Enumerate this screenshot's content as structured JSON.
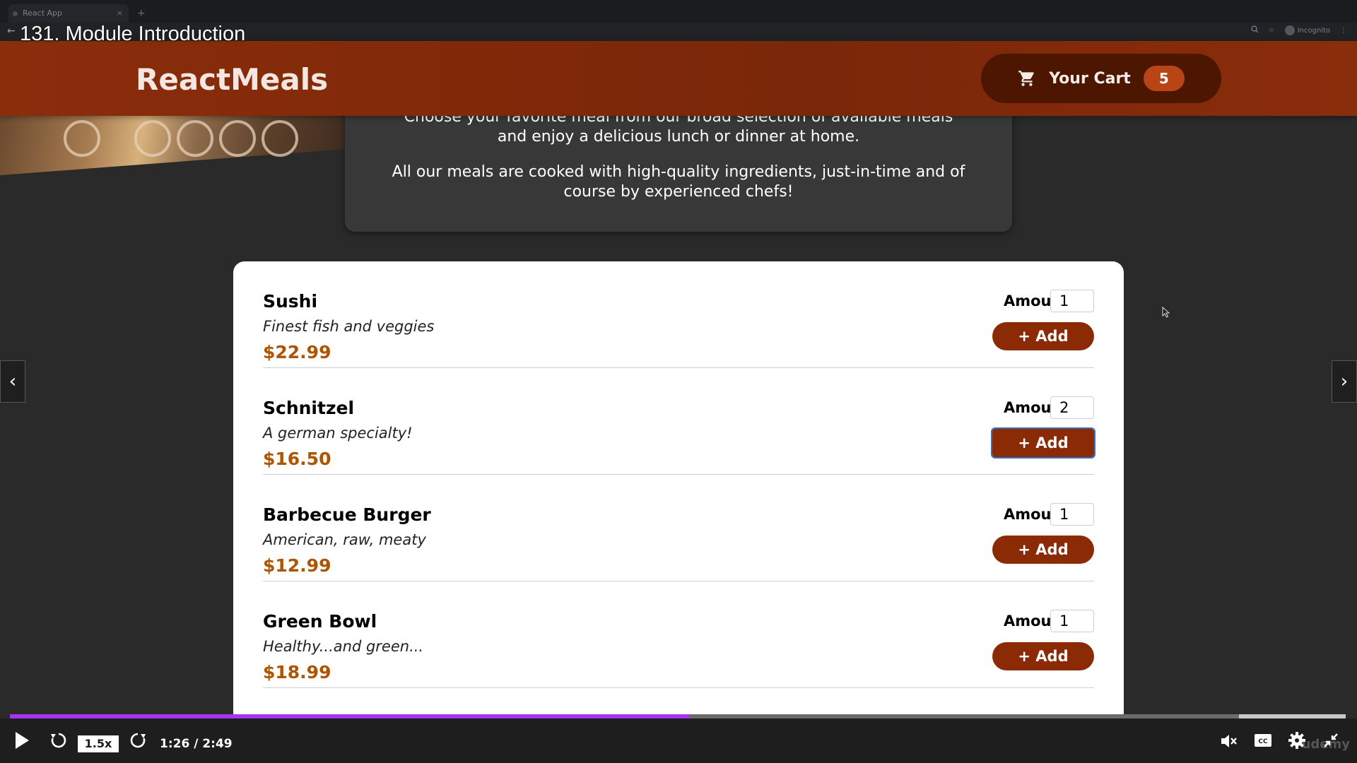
{
  "browser": {
    "tab_title": "React App",
    "new_tab_symbol": "+",
    "tab_close_symbol": "×",
    "incognito_label": "Incognito"
  },
  "video": {
    "title": "131. Module Introduction",
    "speed": "1.5x",
    "time": "1:26 / 2:49",
    "progress_fraction": 0.509,
    "buffered_fraction": 0.92,
    "watermark": "udemy",
    "accent_color": "#a435f0"
  },
  "app": {
    "brand": "ReactMeals",
    "cart": {
      "label": "Your Cart",
      "count": "5",
      "icon": "cart-icon"
    }
  },
  "summary": {
    "paragraph1": "Choose your favorite meal from our broad selection of available meals and enjoy a delicious lunch or dinner at home.",
    "paragraph2": "All our meals are cooked with high-quality ingredients, just-in-time and of course by experienced chefs!"
  },
  "meals": {
    "amount_label": "Amount",
    "add_label": "+ Add",
    "items": [
      {
        "name": "Sushi",
        "description": "Finest fish and veggies",
        "price": "$22.99",
        "amount": "1"
      },
      {
        "name": "Schnitzel",
        "description": "A german specialty!",
        "price": "$16.50",
        "amount": "2"
      },
      {
        "name": "Barbecue Burger",
        "description": "American, raw, meaty",
        "price": "$12.99",
        "amount": "1"
      },
      {
        "name": "Green Bowl",
        "description": "Healthy...and green...",
        "price": "$18.99",
        "amount": "1"
      }
    ]
  },
  "colors": {
    "header": "#8a2d0b",
    "button": "#8a2b06",
    "price": "#ad5502",
    "badge": "#b94517"
  }
}
